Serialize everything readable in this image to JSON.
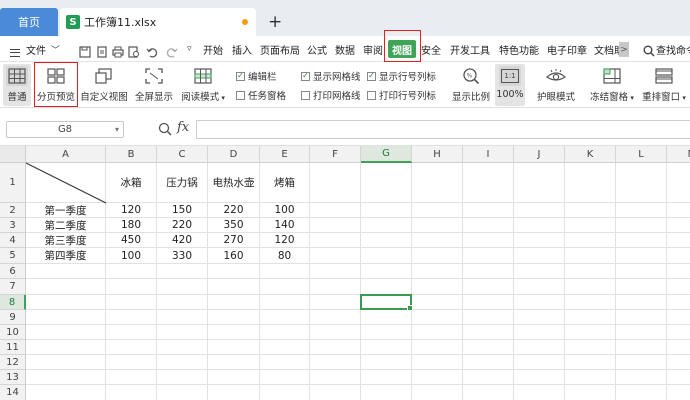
{
  "tabs": {
    "home_label": "首页",
    "file_name": "工作簿11.xlsx",
    "file_icon_letter": "S",
    "new_tab_symbol": "+"
  },
  "menubar": {
    "file_label": "文件",
    "items": [
      "开始",
      "插入",
      "页面布局",
      "公式",
      "数据",
      "审阅",
      "视图",
      "安全",
      "开发工具",
      "特色功能",
      "电子印章",
      "文档助"
    ],
    "active_item": "视图",
    "more_symbol": ">",
    "search_label": "查找命令"
  },
  "ribbon": {
    "normal_label": "普通",
    "page_break_preview_label": "分页预览",
    "custom_view_label": "自定义视图",
    "full_screen_label": "全屏显示",
    "reading_mode_label": "阅读模式",
    "checkboxes": {
      "edit_bar": {
        "label": "编辑栏",
        "checked": true
      },
      "task_pane": {
        "label": "任务窗格",
        "checked": false
      },
      "show_gridlines": {
        "label": "显示网格线",
        "checked": true
      },
      "print_gridlines": {
        "label": "打印网格线",
        "checked": false
      },
      "show_headers": {
        "label": "显示行号列标",
        "checked": true
      },
      "print_headers": {
        "label": "打印行号列标",
        "checked": false
      }
    },
    "zoom_label": "显示比例",
    "zoom_100_label": "100%",
    "zoom_icon_text": "1:1",
    "eye_mode_label": "护眼模式",
    "freeze_label": "冻结窗格",
    "arrange_label": "重排窗口"
  },
  "formula": {
    "cell_ref": "G8",
    "fx": "fx",
    "value": ""
  },
  "sheet": {
    "columns": [
      "A",
      "B",
      "C",
      "D",
      "E",
      "F",
      "G",
      "H",
      "I",
      "J",
      "K",
      "L",
      "M"
    ],
    "rows": [
      "1",
      "2",
      "3",
      "4",
      "5",
      "6",
      "7",
      "8",
      "9",
      "10",
      "11",
      "12",
      "13",
      "14"
    ],
    "selected_col": "G",
    "selected_row": "8",
    "headers": [
      "冰箱",
      "压力锅",
      "电热水壶",
      "烤箱"
    ],
    "data": [
      [
        "第一季度",
        "120",
        "150",
        "220",
        "100"
      ],
      [
        "第二季度",
        "180",
        "220",
        "350",
        "140"
      ],
      [
        "第三季度",
        "450",
        "420",
        "270",
        "120"
      ],
      [
        "第四季度",
        "100",
        "330",
        "160",
        "80"
      ]
    ]
  },
  "colors": {
    "accent_green": "#3fa358",
    "home_tab_blue": "#4a8ad7",
    "highlight_red": "#e02020"
  }
}
